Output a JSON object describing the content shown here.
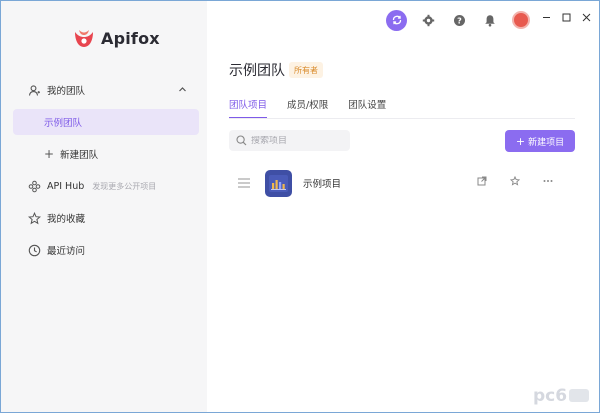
{
  "app": {
    "name": "Apifox"
  },
  "sidebar": {
    "team_group_label": "我的团队",
    "selected_team": "示例团队",
    "new_team_label": "新建团队",
    "api_hub_label": "API Hub",
    "api_hub_hint": "发现更多公开项目",
    "favorites_label": "我的收藏",
    "recent_label": "最近访问"
  },
  "topbar": {
    "icons": [
      "sync-icon",
      "gear-icon",
      "help-icon",
      "bell-icon",
      "avatar"
    ],
    "window_controls": [
      "minimize",
      "maximize",
      "close"
    ]
  },
  "main": {
    "title": "示例团队",
    "owner_badge": "所有者",
    "tabs": [
      {
        "label": "团队项目",
        "active": true
      },
      {
        "label": "成员/权限",
        "active": false
      },
      {
        "label": "团队设置",
        "active": false
      }
    ],
    "search": {
      "placeholder": "搜索项目",
      "value": ""
    },
    "new_project_label": "新建项目",
    "projects": [
      {
        "name": "示例项目"
      }
    ]
  },
  "colors": {
    "accent": "#8b6cf0",
    "accent_text": "#7e5ae8",
    "selected_bg": "#eae4f9",
    "badge_bg": "#fdf2e3",
    "badge_text": "#d98a2a",
    "sidebar_bg": "#f6f6f7",
    "logo_red": "#e8454f"
  },
  "watermark": {
    "text": "pc6"
  }
}
